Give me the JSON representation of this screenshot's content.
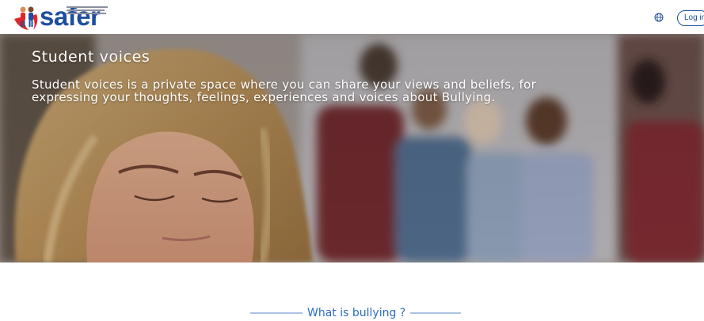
{
  "header": {
    "logo_text": "safer",
    "login_label": "Log in",
    "icons": [
      "logo-figures-icon",
      "globe-icon"
    ],
    "brand_color": "#1d4e9e"
  },
  "hero": {
    "title": "Student voices",
    "description": "Student voices is a private space where you can share your views and beliefs, for expressing your thoughts, feelings, experiences and voices about Bullying."
  },
  "section": {
    "heading": "What is bullying ?",
    "accent_color": "#2b6cc4"
  }
}
